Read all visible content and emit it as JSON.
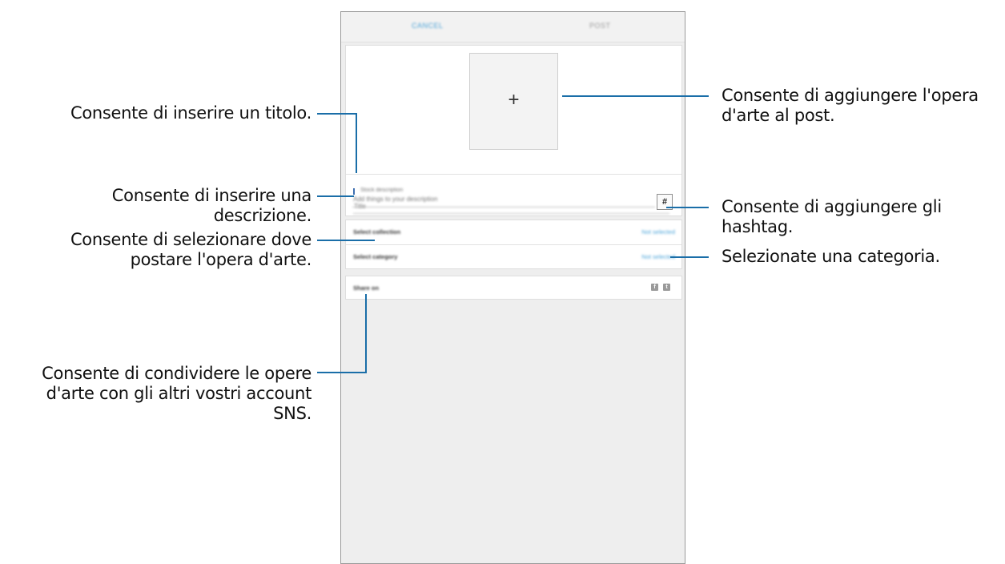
{
  "screen": {
    "tabs": {
      "cancel": "CANCEL",
      "post": "POST"
    },
    "artwork": {
      "add_symbol": "+"
    },
    "section_label": "Stock description",
    "title_field": {
      "placeholder": "Title"
    },
    "description_field": {
      "placeholder": "Add things to your description"
    },
    "hashtag_button": "#",
    "select_collection": {
      "label": "Select collection",
      "value": "Not selected"
    },
    "select_category": {
      "label": "Select category",
      "value": "Not selected"
    },
    "share": {
      "label": "Share on",
      "icons": [
        "facebook-icon",
        "twitter-icon"
      ]
    }
  },
  "callouts": {
    "title": "Consente di inserire un titolo.",
    "description": [
      "Consente di inserire una",
      "descrizione."
    ],
    "collection": [
      "Consente di selezionare dove",
      "postare l'opera d'arte."
    ],
    "share": [
      "Consente di condividere le opere",
      "d'arte con gli altri vostri account",
      "SNS."
    ],
    "artwork": [
      "Consente di aggiungere l'opera",
      "d'arte al post."
    ],
    "hashtag": [
      "Consente di aggiungere gli",
      "hashtag."
    ],
    "category": "Selezionate una categoria."
  },
  "colors": {
    "callout_line": "#1a6ea8",
    "accent": "#4ba3d8"
  }
}
